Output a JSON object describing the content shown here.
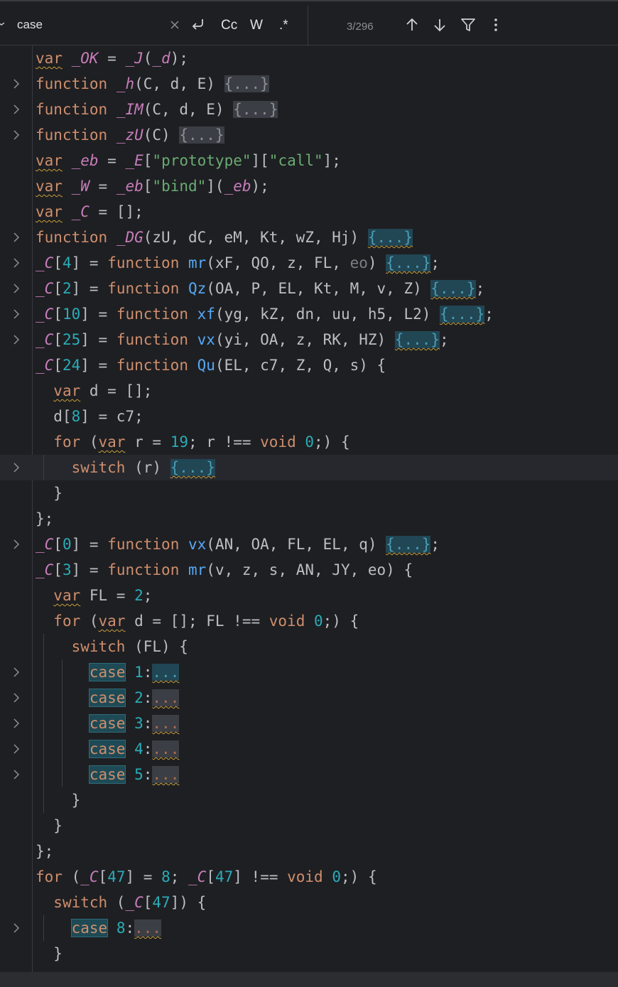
{
  "find_bar": {
    "query": "case",
    "clear_icon": "close-icon",
    "newline_icon": "return-icon",
    "match_case_label": "Cc",
    "words_label": "W",
    "regex_label": ".*",
    "counter": "3/296",
    "prev_icon": "arrow-up-icon",
    "next_icon": "arrow-down-icon",
    "filter_icon": "filter-icon",
    "more_icon": "more-vertical-icon"
  },
  "editor": {
    "lines": [
      {
        "fold": false,
        "guides": [],
        "parts": [
          [
            "var",
            "kw wv"
          ],
          [
            " ",
            ""
          ],
          [
            "_OK",
            "gl"
          ],
          [
            " = ",
            ""
          ],
          [
            "_J",
            "gl"
          ],
          [
            "(",
            ""
          ],
          [
            "_d",
            "gl"
          ],
          [
            ");",
            ""
          ]
        ]
      },
      {
        "fold": true,
        "guides": [],
        "parts": [
          [
            "function",
            "kw"
          ],
          [
            " ",
            ""
          ],
          [
            "_h",
            "gl"
          ],
          [
            "(C, d, E) ",
            ""
          ],
          [
            "{...}",
            "fphl"
          ]
        ]
      },
      {
        "fold": true,
        "guides": [],
        "parts": [
          [
            "function",
            "kw"
          ],
          [
            " ",
            ""
          ],
          [
            "_IM",
            "gl"
          ],
          [
            "(C, d, E) ",
            ""
          ],
          [
            "{...}",
            "fphl"
          ]
        ]
      },
      {
        "fold": true,
        "guides": [],
        "parts": [
          [
            "function",
            "kw"
          ],
          [
            " ",
            ""
          ],
          [
            "_zU",
            "gl"
          ],
          [
            "(C) ",
            ""
          ],
          [
            "{...}",
            "fphl"
          ]
        ]
      },
      {
        "fold": false,
        "guides": [],
        "parts": [
          [
            "var",
            "kw wv"
          ],
          [
            " ",
            ""
          ],
          [
            "_eb",
            "gl"
          ],
          [
            " = ",
            ""
          ],
          [
            "_E",
            "gl"
          ],
          [
            "[",
            ""
          ],
          [
            "\"prototype\"",
            "str"
          ],
          [
            "][",
            ""
          ],
          [
            "\"call\"",
            "str"
          ],
          [
            "];",
            ""
          ]
        ]
      },
      {
        "fold": false,
        "guides": [],
        "parts": [
          [
            "var",
            "kw wv"
          ],
          [
            " ",
            ""
          ],
          [
            "_W",
            "gl"
          ],
          [
            " = ",
            ""
          ],
          [
            "_eb",
            "gl"
          ],
          [
            "[",
            ""
          ],
          [
            "\"bind\"",
            "str"
          ],
          [
            "](",
            ""
          ],
          [
            "_eb",
            "gl"
          ],
          [
            ");",
            ""
          ]
        ]
      },
      {
        "fold": false,
        "guides": [],
        "parts": [
          [
            "var",
            "kw wv"
          ],
          [
            " ",
            ""
          ],
          [
            "_C",
            "gl"
          ],
          [
            " = [];",
            ""
          ]
        ]
      },
      {
        "fold": true,
        "guides": [],
        "parts": [
          [
            "function",
            "kw"
          ],
          [
            " ",
            ""
          ],
          [
            "_DG",
            "gl"
          ],
          [
            "(zU, dC, eM, Kt, wZ, Hj) ",
            ""
          ],
          [
            "{...}",
            "fpsel"
          ]
        ]
      },
      {
        "fold": true,
        "guides": [],
        "parts": [
          [
            "_C",
            "gl"
          ],
          [
            "[",
            ""
          ],
          [
            "4",
            "num"
          ],
          [
            "] = ",
            ""
          ],
          [
            "function",
            "kw"
          ],
          [
            " ",
            ""
          ],
          [
            "mr",
            "fn"
          ],
          [
            "(xF, QO, z, FL, ",
            ""
          ],
          [
            "eo",
            "cm"
          ],
          [
            ") ",
            ""
          ],
          [
            "{...}",
            "fpsel"
          ],
          [
            ";",
            ""
          ]
        ]
      },
      {
        "fold": true,
        "guides": [],
        "parts": [
          [
            "_C",
            "gl"
          ],
          [
            "[",
            ""
          ],
          [
            "2",
            "num"
          ],
          [
            "] = ",
            ""
          ],
          [
            "function",
            "kw"
          ],
          [
            " ",
            ""
          ],
          [
            "Qz",
            "fn"
          ],
          [
            "(OA, P, EL, Kt, M, v, Z) ",
            ""
          ],
          [
            "{...}",
            "fpsel"
          ],
          [
            ";",
            ""
          ]
        ]
      },
      {
        "fold": true,
        "guides": [],
        "parts": [
          [
            "_C",
            "gl"
          ],
          [
            "[",
            ""
          ],
          [
            "10",
            "num"
          ],
          [
            "] = ",
            ""
          ],
          [
            "function",
            "kw"
          ],
          [
            " ",
            ""
          ],
          [
            "xf",
            "fn"
          ],
          [
            "(yg, kZ, dn, uu, h5, L2) ",
            ""
          ],
          [
            "{...}",
            "fpsel"
          ],
          [
            ";",
            ""
          ]
        ]
      },
      {
        "fold": true,
        "guides": [],
        "parts": [
          [
            "_C",
            "gl"
          ],
          [
            "[",
            ""
          ],
          [
            "25",
            "num"
          ],
          [
            "] = ",
            ""
          ],
          [
            "function",
            "kw"
          ],
          [
            " ",
            ""
          ],
          [
            "vx",
            "fn"
          ],
          [
            "(yi, OA, z, RK, HZ) ",
            ""
          ],
          [
            "{...}",
            "fpsel"
          ],
          [
            ";",
            ""
          ]
        ]
      },
      {
        "fold": false,
        "guides": [],
        "parts": [
          [
            "_C",
            "gl"
          ],
          [
            "[",
            ""
          ],
          [
            "24",
            "num"
          ],
          [
            "] = ",
            ""
          ],
          [
            "function",
            "kw"
          ],
          [
            " ",
            ""
          ],
          [
            "Qu",
            "fn"
          ],
          [
            "(EL, c7, Z, Q, s) {",
            ""
          ]
        ]
      },
      {
        "fold": false,
        "guides": [],
        "parts": [
          [
            "  ",
            ""
          ],
          [
            "var",
            "kw wv"
          ],
          [
            " d = [];",
            ""
          ]
        ]
      },
      {
        "fold": false,
        "guides": [],
        "parts": [
          [
            "  d[",
            ""
          ],
          [
            "8",
            "num"
          ],
          [
            "] = c7;",
            ""
          ]
        ]
      },
      {
        "fold": false,
        "guides": [],
        "parts": [
          [
            "  ",
            ""
          ],
          [
            "for",
            "kw"
          ],
          [
            " (",
            ""
          ],
          [
            "var",
            "kw wv"
          ],
          [
            " r = ",
            ""
          ],
          [
            "19",
            "num"
          ],
          [
            "; r !== ",
            ""
          ],
          [
            "void",
            "kw"
          ],
          [
            " ",
            ""
          ],
          [
            "0",
            "num"
          ],
          [
            ";) {",
            ""
          ]
        ]
      },
      {
        "fold": true,
        "current": true,
        "guides": [
          1
        ],
        "parts": [
          [
            "    ",
            ""
          ],
          [
            "switch",
            "kw"
          ],
          [
            " (r) ",
            ""
          ],
          [
            "{...}",
            "fpsel"
          ]
        ]
      },
      {
        "fold": false,
        "guides": [],
        "parts": [
          [
            "  }",
            ""
          ]
        ]
      },
      {
        "fold": false,
        "guides": [],
        "parts": [
          [
            "};",
            ""
          ]
        ]
      },
      {
        "fold": true,
        "guides": [],
        "parts": [
          [
            "_C",
            "gl"
          ],
          [
            "[",
            ""
          ],
          [
            "0",
            "num"
          ],
          [
            "] = ",
            ""
          ],
          [
            "function",
            "kw"
          ],
          [
            " ",
            ""
          ],
          [
            "vx",
            "fn"
          ],
          [
            "(AN, OA, FL, EL, q) ",
            ""
          ],
          [
            "{...}",
            "fpsel"
          ],
          [
            ";",
            ""
          ]
        ]
      },
      {
        "fold": false,
        "guides": [],
        "parts": [
          [
            "_C",
            "gl"
          ],
          [
            "[",
            ""
          ],
          [
            "3",
            "num"
          ],
          [
            "] = ",
            ""
          ],
          [
            "function",
            "kw"
          ],
          [
            " ",
            ""
          ],
          [
            "mr",
            "fn"
          ],
          [
            "(v, z, s, AN, JY, eo) {",
            ""
          ]
        ]
      },
      {
        "fold": false,
        "guides": [],
        "parts": [
          [
            "  ",
            ""
          ],
          [
            "var",
            "kw wv"
          ],
          [
            " FL = ",
            ""
          ],
          [
            "2",
            "num"
          ],
          [
            ";",
            ""
          ]
        ]
      },
      {
        "fold": false,
        "guides": [],
        "parts": [
          [
            "  ",
            ""
          ],
          [
            "for",
            "kw"
          ],
          [
            " (",
            ""
          ],
          [
            "var",
            "kw wv"
          ],
          [
            " d = []; FL !== ",
            ""
          ],
          [
            "void",
            "kw"
          ],
          [
            " ",
            ""
          ],
          [
            "0",
            "num"
          ],
          [
            ";) {",
            ""
          ]
        ]
      },
      {
        "fold": false,
        "guides": [
          1
        ],
        "parts": [
          [
            "    ",
            ""
          ],
          [
            "switch",
            "kw"
          ],
          [
            " (FL) {",
            ""
          ]
        ]
      },
      {
        "fold": true,
        "guides": [
          1,
          2
        ],
        "parts": [
          [
            "      ",
            ""
          ],
          [
            "case",
            "kw match"
          ],
          [
            " ",
            ""
          ],
          [
            "1",
            "num"
          ],
          [
            ":",
            ""
          ],
          [
            "...",
            "fpsel"
          ]
        ]
      },
      {
        "fold": true,
        "guides": [
          1,
          2
        ],
        "parts": [
          [
            "      ",
            ""
          ],
          [
            "case",
            "kw match"
          ],
          [
            " ",
            ""
          ],
          [
            "2",
            "num"
          ],
          [
            ":",
            ""
          ],
          [
            "...",
            "fpdots"
          ]
        ]
      },
      {
        "fold": true,
        "guides": [
          1,
          2
        ],
        "parts": [
          [
            "      ",
            ""
          ],
          [
            "case",
            "kw match"
          ],
          [
            " ",
            ""
          ],
          [
            "3",
            "num"
          ],
          [
            ":",
            ""
          ],
          [
            "...",
            "fpdots"
          ]
        ]
      },
      {
        "fold": true,
        "guides": [
          1,
          2
        ],
        "parts": [
          [
            "      ",
            ""
          ],
          [
            "case",
            "kw match"
          ],
          [
            " ",
            ""
          ],
          [
            "4",
            "num"
          ],
          [
            ":",
            ""
          ],
          [
            "...",
            "fpdots"
          ]
        ]
      },
      {
        "fold": true,
        "guides": [
          1,
          2
        ],
        "parts": [
          [
            "      ",
            ""
          ],
          [
            "case",
            "kw match"
          ],
          [
            " ",
            ""
          ],
          [
            "5",
            "num"
          ],
          [
            ":",
            ""
          ],
          [
            "...",
            "fpdots"
          ]
        ]
      },
      {
        "fold": false,
        "guides": [
          1
        ],
        "parts": [
          [
            "    }",
            ""
          ]
        ]
      },
      {
        "fold": false,
        "guides": [],
        "parts": [
          [
            "  }",
            ""
          ]
        ]
      },
      {
        "fold": false,
        "guides": [],
        "parts": [
          [
            "};",
            ""
          ]
        ]
      },
      {
        "fold": false,
        "guides": [],
        "parts": [
          [
            "for",
            "kw"
          ],
          [
            " (",
            ""
          ],
          [
            "_C",
            "gl"
          ],
          [
            "[",
            ""
          ],
          [
            "47",
            "num"
          ],
          [
            "] = ",
            ""
          ],
          [
            "8",
            "num"
          ],
          [
            "; ",
            ""
          ],
          [
            "_C",
            "gl"
          ],
          [
            "[",
            ""
          ],
          [
            "47",
            "num"
          ],
          [
            "] !== ",
            ""
          ],
          [
            "void",
            "kw"
          ],
          [
            " ",
            ""
          ],
          [
            "0",
            "num"
          ],
          [
            ";) {",
            ""
          ]
        ]
      },
      {
        "fold": false,
        "guides": [],
        "parts": [
          [
            "  ",
            ""
          ],
          [
            "switch",
            "kw"
          ],
          [
            " (",
            ""
          ],
          [
            "_C",
            "gl"
          ],
          [
            "[",
            ""
          ],
          [
            "47",
            "num"
          ],
          [
            "]) {",
            ""
          ]
        ]
      },
      {
        "fold": true,
        "guides": [
          1
        ],
        "parts": [
          [
            "    ",
            ""
          ],
          [
            "case",
            "kw match"
          ],
          [
            " ",
            ""
          ],
          [
            "8",
            "num"
          ],
          [
            ":",
            ""
          ],
          [
            "...",
            "fpdots"
          ]
        ]
      },
      {
        "fold": false,
        "guides": [],
        "parts": [
          [
            "  }",
            ""
          ]
        ]
      }
    ]
  }
}
